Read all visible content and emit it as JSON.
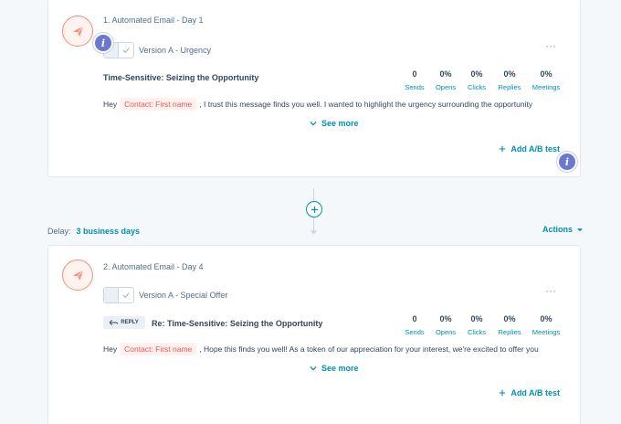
{
  "steps": [
    {
      "title": "1. Automated Email - Day 1",
      "version": "Version A - Urgency",
      "subject": "Time-Sensitive: Seizing the Opportunity",
      "body_prefix": "Hey",
      "token": "Contact: First name",
      "body_suffix": ", I trust this message finds you well. I wanted to highlight the urgency surrounding the opportunity",
      "see_more": "See more",
      "add_ab": "Add A/B test",
      "stats": [
        {
          "value": "0",
          "label": "Sends"
        },
        {
          "value": "0%",
          "label": "Opens"
        },
        {
          "value": "0%",
          "label": "Clicks"
        },
        {
          "value": "0%",
          "label": "Replies"
        },
        {
          "value": "0%",
          "label": "Meetings"
        }
      ]
    },
    {
      "title": "2. Automated Email - Day 4",
      "version": "Version A - Special Offer",
      "reply_label": "REPLY",
      "subject": "Re: Time-Sensitive: Seizing the Opportunity",
      "body_prefix": "Hey",
      "token": "Contact: First name",
      "body_suffix": ", Hope this finds you well! As a token of our appreciation for your interest, we're excited to offer you",
      "see_more": "See more",
      "add_ab": "Add A/B test",
      "stats": [
        {
          "value": "0",
          "label": "Sends"
        },
        {
          "value": "0%",
          "label": "Opens"
        },
        {
          "value": "0%",
          "label": "Clicks"
        },
        {
          "value": "0%",
          "label": "Replies"
        },
        {
          "value": "0%",
          "label": "Meetings"
        }
      ]
    }
  ],
  "delay": {
    "label": "Delay:",
    "value": "3 business days"
  },
  "actions_label": "Actions",
  "more_glyph": "···",
  "info_glyph": "i",
  "colors": {
    "accent": "#0091ae",
    "token_text": "#f2545b",
    "step_icon": "#f58d7a",
    "info_badge": "#6a78d1"
  },
  "icons": {
    "step": "paper-plane-icon",
    "toggle": "check-icon",
    "see_more": "chevron-down-icon",
    "add": "plus-icon",
    "reply": "reply-arrow-icon",
    "actions": "caret-down-icon"
  }
}
